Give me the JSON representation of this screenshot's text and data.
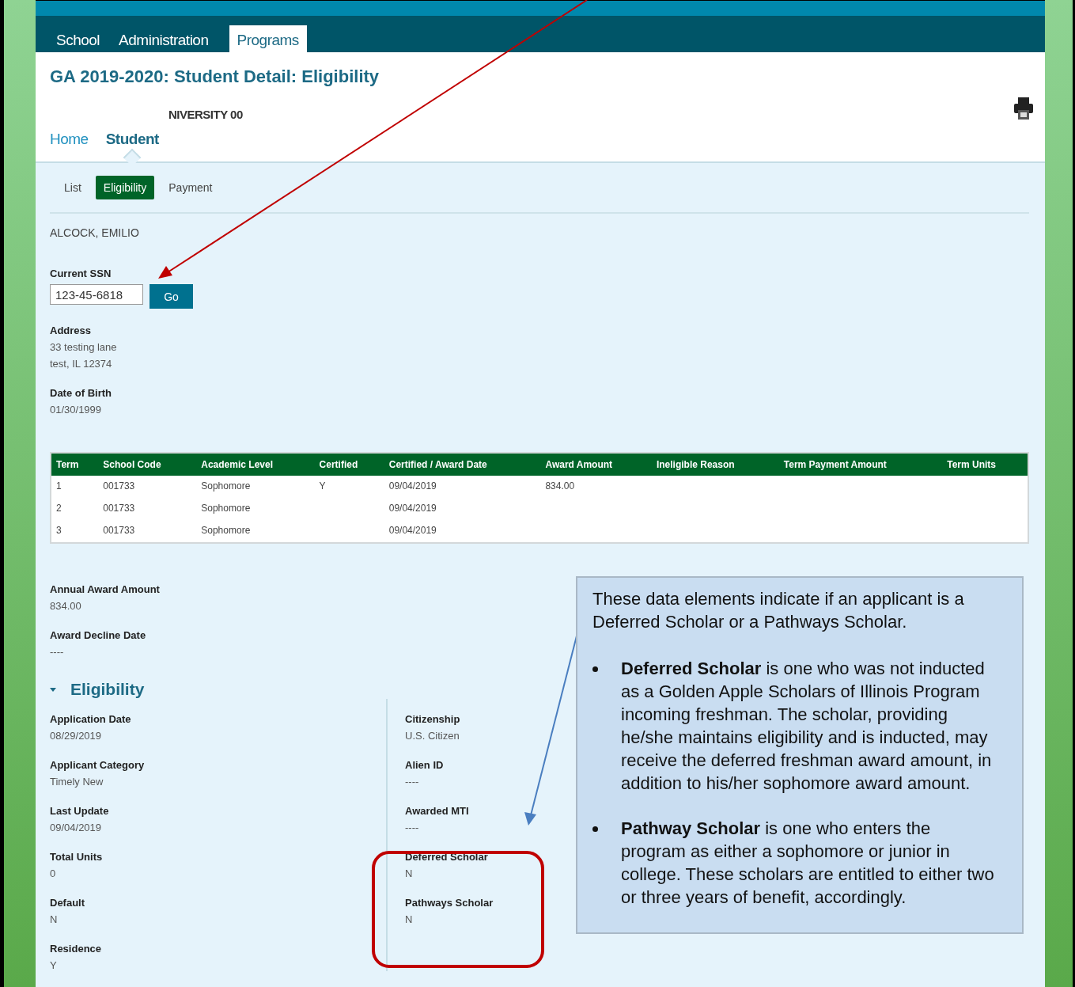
{
  "nav_tabs": [
    {
      "label": "School",
      "selected": false
    },
    {
      "label": "Administration",
      "selected": false
    },
    {
      "label": "Programs",
      "selected": true
    }
  ],
  "page_title": "GA 2019-2020: Student Detail: Eligibility",
  "institution": "NIVERSITY 00",
  "breadcrumbs": [
    {
      "label": "Home",
      "selected": false
    },
    {
      "label": "Student",
      "selected": true
    }
  ],
  "sub_tabs": [
    {
      "label": "List",
      "selected": false
    },
    {
      "label": "Eligibility",
      "selected": true
    },
    {
      "label": "Payment",
      "selected": false
    }
  ],
  "student_name": "ALCOCK, EMILIO",
  "ssn": {
    "label": "Current SSN",
    "value": "123-45-6818",
    "button": "Go"
  },
  "address": {
    "label": "Address",
    "lines": [
      "33 testing lane",
      "test, IL 12374"
    ]
  },
  "dob": {
    "label": "Date of Birth",
    "value": "01/30/1999"
  },
  "table": {
    "columns": [
      "Term",
      "School Code",
      "Academic Level",
      "Certified",
      "Certified / Award Date",
      "Award Amount",
      "Ineligible Reason",
      "Term Payment Amount",
      "Term Units"
    ],
    "rows": [
      [
        "1",
        "001733",
        "Sophomore",
        "Y",
        "09/04/2019",
        "834.00",
        "",
        "",
        ""
      ],
      [
        "2",
        "001733",
        "Sophomore",
        "",
        "09/04/2019",
        "",
        "",
        "",
        ""
      ],
      [
        "3",
        "001733",
        "Sophomore",
        "",
        "09/04/2019",
        "",
        "",
        "",
        ""
      ]
    ]
  },
  "award_fields": [
    {
      "label": "Annual Award Amount",
      "value": "834.00"
    },
    {
      "label": "Award Decline Date",
      "value": "----"
    }
  ],
  "eligibility": {
    "title": "Eligibility",
    "expanded": true,
    "left": [
      {
        "label": "Application Date",
        "value": "08/29/2019"
      },
      {
        "label": "Applicant Category",
        "value": "Timely New"
      },
      {
        "label": "Last Update",
        "value": "09/04/2019"
      },
      {
        "label": "Total Units",
        "value": "0"
      },
      {
        "label": "Default",
        "value": "N"
      },
      {
        "label": "Residence",
        "value": "Y"
      }
    ],
    "right": [
      {
        "label": "Citizenship",
        "value": "U.S. Citizen"
      },
      {
        "label": "Alien ID",
        "value": "----"
      },
      {
        "label": "Awarded MTI",
        "value": "----"
      },
      {
        "label": "Deferred Scholar",
        "value": "N"
      },
      {
        "label": "Pathways Scholar",
        "value": "N"
      }
    ]
  },
  "callout": {
    "intro": "These data elements indicate if an applicant is a Deferred Scholar or a Pathways Scholar.",
    "bullets": [
      "**Deferred Scholar** is one who was not inducted as a Golden Apple Scholars of Illinois Program incoming freshman. The scholar, providing he/she maintains eligibility and is inducted, may receive the deferred freshman award amount, in addition to his/her sophomore award amount.",
      "**Pathway Scholar** is one who enters the program as either a sophomore or junior in college. These scholars are entitled to either two or three years of benefit,  accordingly."
    ]
  }
}
